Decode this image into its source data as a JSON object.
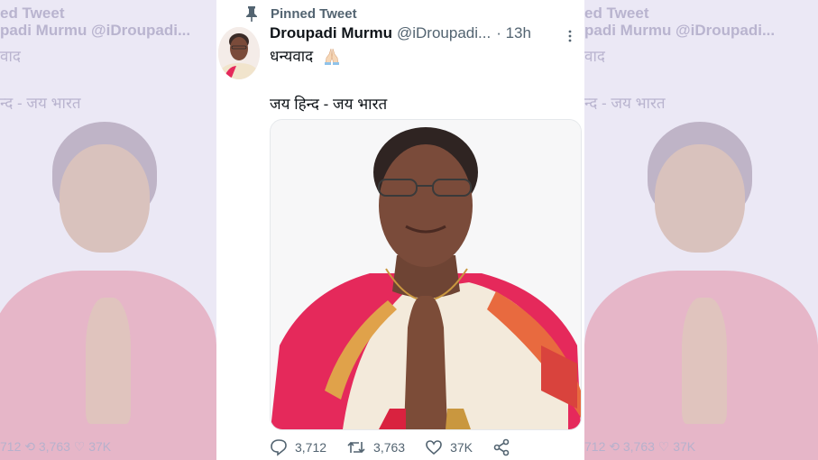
{
  "tweet": {
    "pinned_label": "Pinned Tweet",
    "author_name": "Droupadi Murmu",
    "handle": "@iDroupadi...",
    "time": "· 13h",
    "line1": "धन्यवाद",
    "line2": "जय हिन्द - जय भारत"
  },
  "actions": {
    "replies": "3,712",
    "retweets": "3,763",
    "likes": "37K"
  },
  "ghost_left": {
    "pinned_label": "ed Tweet",
    "author_line": "padi Murmu @iDroupadi...",
    "line1": "वाद",
    "line2": "न्द - जय भारत",
    "actions": "712    ⟲ 3,763    ♡ 37K"
  },
  "ghost_right": {
    "pinned_label": "ed Tweet",
    "author_line": "padi Murmu @iDroupadi...",
    "line1": "वाद",
    "line2": "न्द - जय भारत",
    "actions": "712    ⟲ 3,763    ♡ 37K"
  },
  "colors": {
    "text_primary": "#0f1419",
    "text_secondary": "#536471",
    "sari_pink": "#e5295b",
    "sari_cream": "#f3eadb"
  }
}
